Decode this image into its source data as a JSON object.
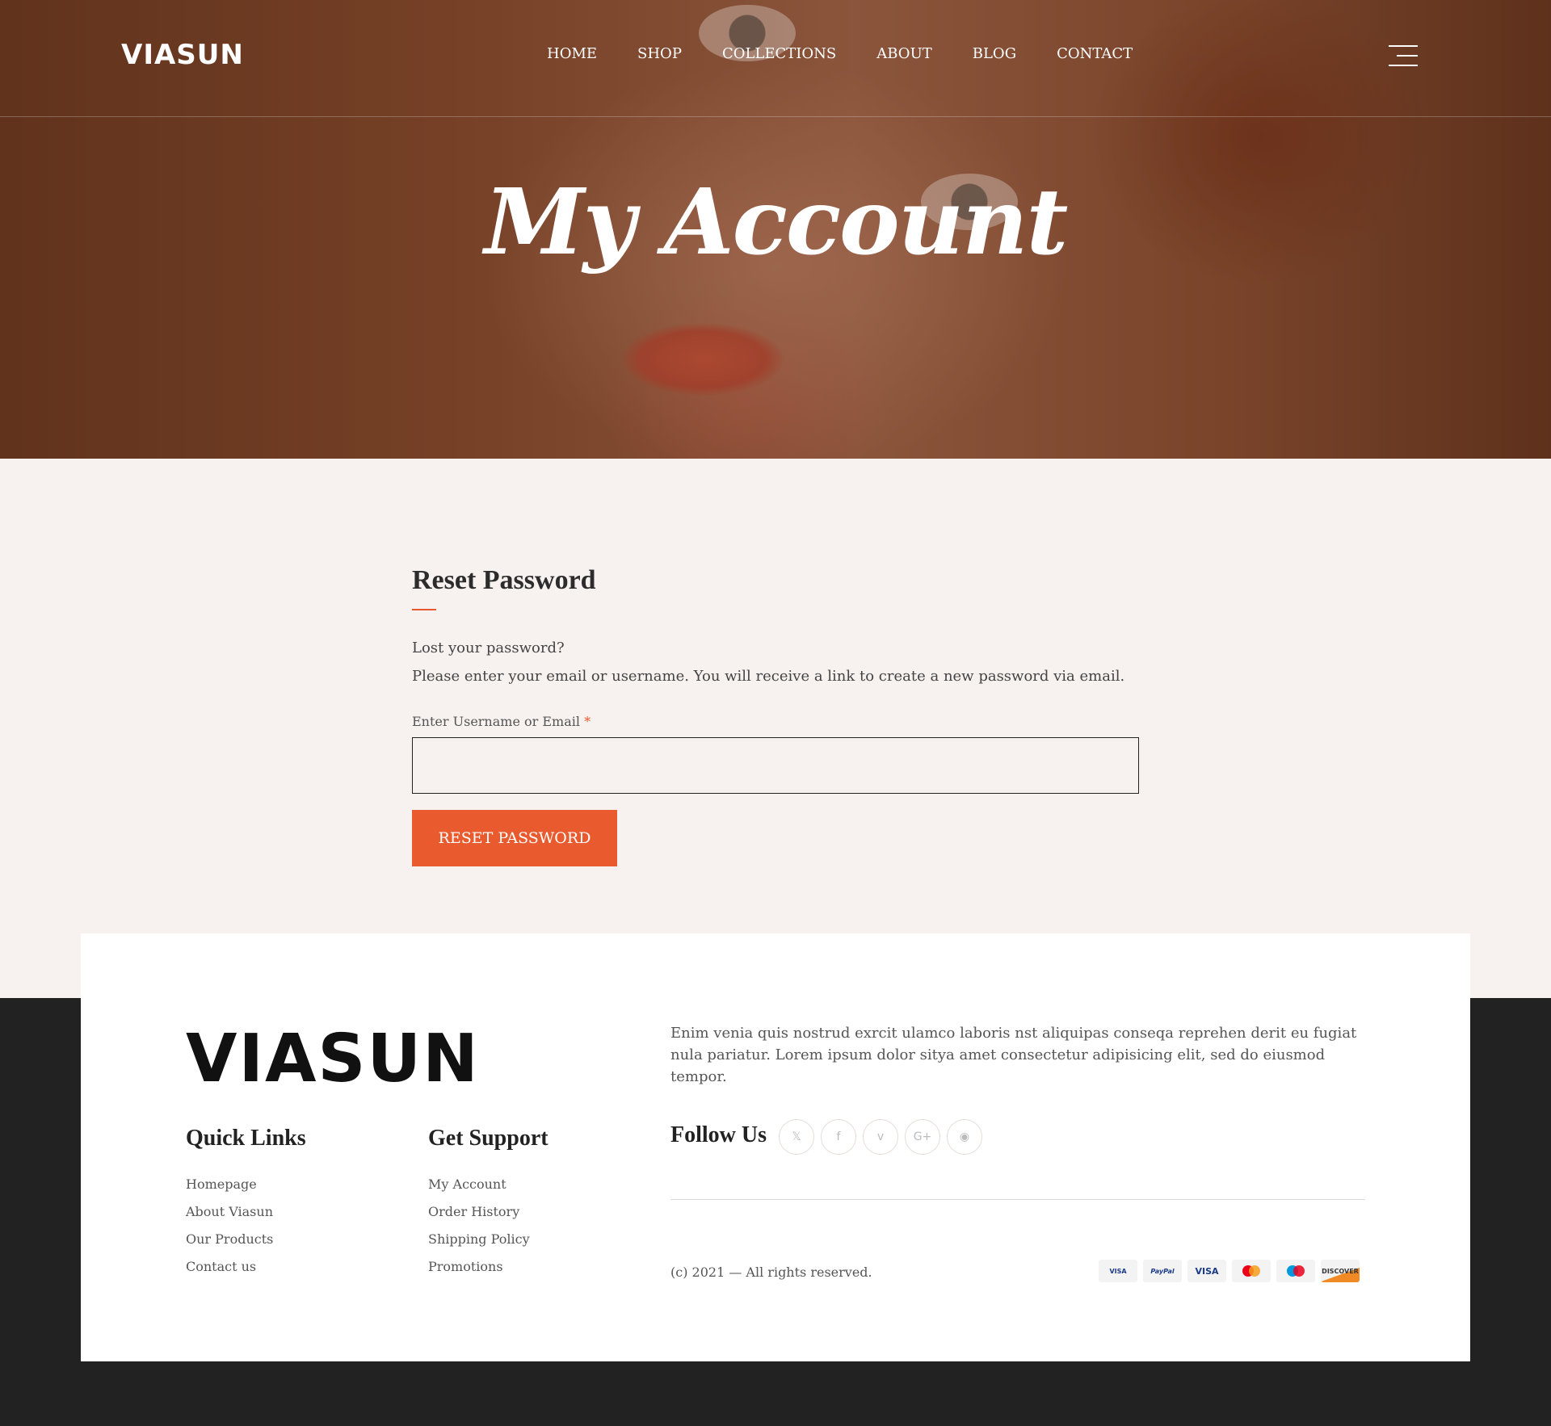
{
  "header": {
    "logo": "VIASUN",
    "nav": [
      "HOME",
      "SHOP",
      "COLLECTIONS",
      "ABOUT",
      "BLOG",
      "CONTACT"
    ],
    "menu_icon": "hamburger-icon"
  },
  "hero": {
    "title": "My Account"
  },
  "reset": {
    "title": "Reset Password",
    "line1": "Lost your password?",
    "line2": "Please enter your email or username. You will receive a link to create a new password via email.",
    "field_label": "Enter Username or Email",
    "required_mark": "*",
    "field_value": "",
    "button": "RESET PASSWORD"
  },
  "footer": {
    "logo": "VIASUN",
    "about": "Enim venia quis nostrud exrcit ulamco laboris nst aliquipas conseqa reprehen derit eu fugiat nula pariatur. Lorem ipsum dolor sitya amet consectetur adipisicing elit, sed do eiusmod tempor.",
    "quick_links": {
      "title": "Quick Links",
      "items": [
        "Homepage",
        "About Viasun",
        "Our Products",
        "Contact us"
      ]
    },
    "support": {
      "title": "Get Support",
      "items": [
        "My Account",
        "Order History",
        "Shipping Policy",
        "Promotions"
      ]
    },
    "follow_title": "Follow Us",
    "socials": [
      "twitter-icon",
      "facebook-icon",
      "vimeo-icon",
      "google-plus-icon",
      "instagram-icon"
    ],
    "copyright": "(c) 2021 — All rights reserved.",
    "payments": [
      "VISA Electron",
      "PayPal",
      "VISA",
      "Mastercard",
      "Maestro",
      "DISCOVER"
    ]
  },
  "colors": {
    "accent": "#e95b2e",
    "footer_bg": "#222222",
    "page_bg": "#f7f2ef"
  }
}
